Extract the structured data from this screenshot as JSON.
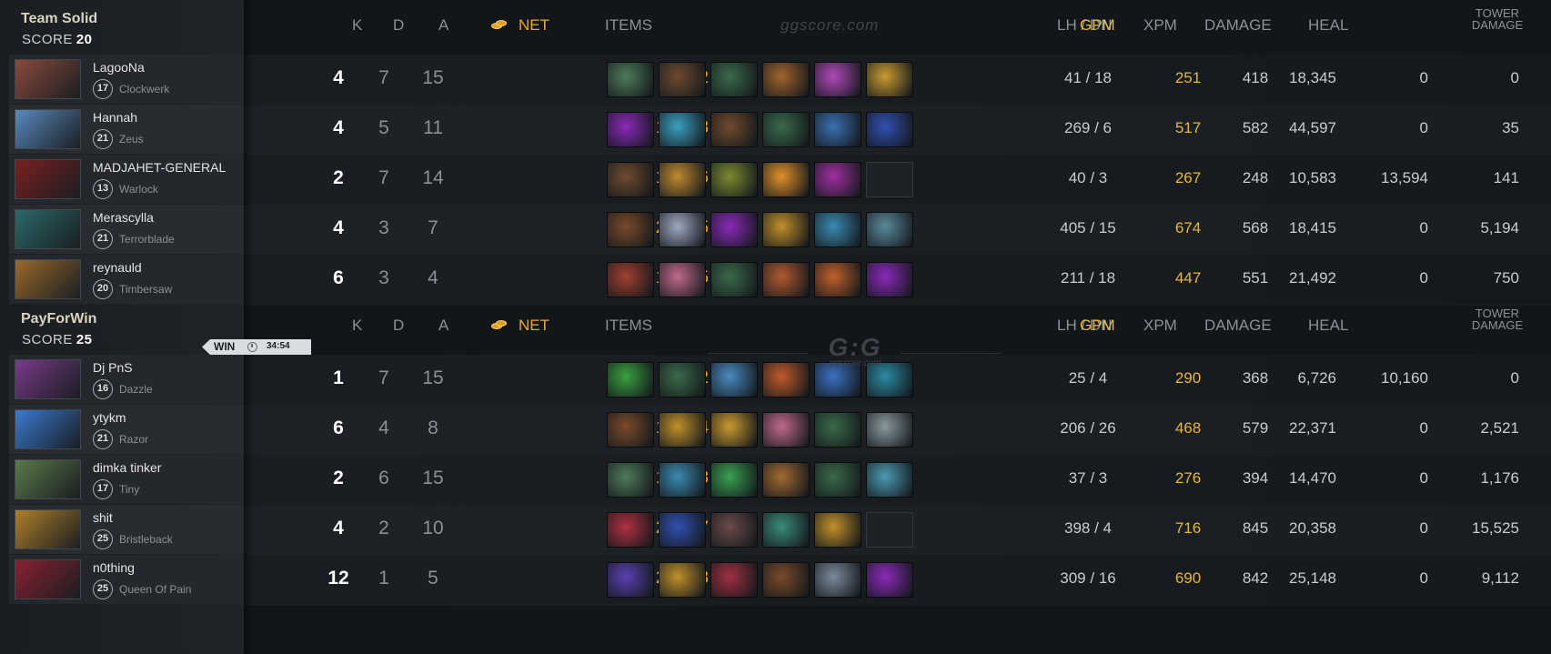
{
  "watermark_top": "ggscore.com",
  "logo": {
    "main": "G:G",
    "sub": "ggscore.com"
  },
  "columns": {
    "k": "K",
    "d": "D",
    "a": "A",
    "net": "NET",
    "items": "ITEMS",
    "lhdn": "LH  /  DN",
    "gpm": "GPM",
    "xpm": "XPM",
    "damage": "DAMAGE",
    "heal": "HEAL",
    "tower_line1": "TOWER",
    "tower_line2": "DAMAGE"
  },
  "result": {
    "label": "WIN",
    "time": "34:54",
    "clock_icon": "clock-icon"
  },
  "colors": {
    "gold": "#e8a830",
    "gpm": "#e8b830",
    "background": "#121619"
  },
  "teams": [
    {
      "name": "Team Solid",
      "score_label": "SCORE",
      "score": "20",
      "players": [
        {
          "name": "LagooNa",
          "level": "17",
          "hero": "Clockwerk",
          "k": "4",
          "d": "7",
          "a": "15",
          "net": "9,182",
          "lhdn": "41  /  18",
          "gpm": "251",
          "xpm": "418",
          "damage": "18,345",
          "heal": "0",
          "tower": "0",
          "portrait": "#8a4a3c",
          "items": [
            "#4f7a5a",
            "#6e4a2e",
            "#3a6a4a",
            "#a0642c",
            "#b04ab8",
            "#c89a30"
          ]
        },
        {
          "name": "Hannah",
          "level": "21",
          "hero": "Zeus",
          "k": "4",
          "d": "5",
          "a": "11",
          "net": "16,473",
          "lhdn": "269  /  6",
          "gpm": "517",
          "xpm": "582",
          "damage": "44,597",
          "heal": "0",
          "tower": "35",
          "portrait": "#5a8ac0",
          "items": [
            "#8a2ab8",
            "#3aa0c0",
            "#6e4a2e",
            "#3a6a4a",
            "#3a70b0",
            "#3050b0"
          ]
        },
        {
          "name": "MADJAHET-GENERAL",
          "level": "13",
          "hero": "Warlock",
          "k": "2",
          "d": "7",
          "a": "14",
          "net": "10,256",
          "lhdn": "40  /  3",
          "gpm": "267",
          "xpm": "248",
          "damage": "10,583",
          "heal": "13,594",
          "tower": "141",
          "portrait": "#7a2020",
          "items": [
            "#6e4a2e",
            "#c08a30",
            "#7a8a30",
            "#e0902a",
            "#a030a0",
            null
          ]
        },
        {
          "name": "Merascylla",
          "level": "21",
          "hero": "Terrorblade",
          "k": "4",
          "d": "3",
          "a": "7",
          "net": "23,405",
          "lhdn": "405  /  15",
          "gpm": "674",
          "xpm": "568",
          "damage": "18,415",
          "heal": "0",
          "tower": "5,194",
          "portrait": "#2a6a6a",
          "items": [
            "#7a4a2a",
            "#a0a8c0",
            "#8a2ab8",
            "#c0902a",
            "#3a8ab0",
            "#5a8a9a"
          ]
        },
        {
          "name": "reynauld",
          "level": "20",
          "hero": "Timbersaw",
          "k": "6",
          "d": "3",
          "a": "4",
          "net": "16,695",
          "lhdn": "211  /  18",
          "gpm": "447",
          "xpm": "551",
          "damage": "21,492",
          "heal": "0",
          "tower": "750",
          "portrait": "#9a6a2a",
          "items": [
            "#a04030",
            "#c06a8a",
            "#3a6a4a",
            "#b05a30",
            "#c0602a",
            "#8a2ab8"
          ]
        }
      ]
    },
    {
      "name": "PayForWin",
      "score_label": "SCORE",
      "score": "25",
      "players": [
        {
          "name": "Dj PnS",
          "level": "16",
          "hero": "Dazzle",
          "k": "1",
          "d": "7",
          "a": "15",
          "net": "9,672",
          "lhdn": "25  /  4",
          "gpm": "290",
          "xpm": "368",
          "damage": "6,726",
          "heal": "10,160",
          "tower": "0",
          "portrait": "#7a3a8a",
          "items": [
            "#3aa040",
            "#3a6a4a",
            "#4a8ac0",
            "#c05a2a",
            "#3a70c0",
            "#2a8aa0"
          ]
        },
        {
          "name": "ytykm",
          "level": "21",
          "hero": "Razor",
          "k": "6",
          "d": "4",
          "a": "8",
          "net": "16,194",
          "lhdn": "206  /  26",
          "gpm": "468",
          "xpm": "579",
          "damage": "22,371",
          "heal": "0",
          "tower": "2,521",
          "portrait": "#3a7ad0",
          "items": [
            "#7a4a2a",
            "#c0902a",
            "#c89a30",
            "#c06a8a",
            "#3a6a4a",
            "#8a9aa0"
          ]
        },
        {
          "name": "dimka tinker",
          "level": "17",
          "hero": "Tiny",
          "k": "2",
          "d": "6",
          "a": "15",
          "net": "10,153",
          "lhdn": "37  /  3",
          "gpm": "276",
          "xpm": "394",
          "damage": "14,470",
          "heal": "0",
          "tower": "1,176",
          "portrait": "#5a7a4a",
          "items": [
            "#4f7a5a",
            "#3a8ab0",
            "#3aa050",
            "#a06a30",
            "#3a6a4a",
            "#4a9ab0"
          ]
        },
        {
          "name": "shit",
          "level": "25",
          "hero": "Bristleback",
          "k": "4",
          "d": "2",
          "a": "10",
          "net": "25,887",
          "lhdn": "398  /  4",
          "gpm": "716",
          "xpm": "845",
          "damage": "20,358",
          "heal": "0",
          "tower": "15,525",
          "portrait": "#b0802a",
          "items": [
            "#b03040",
            "#3050b0",
            "#6a4a4a",
            "#3a8a7a",
            "#c0902a",
            null
          ]
        },
        {
          "name": "n0thing",
          "level": "25",
          "hero": "Queen Of Pain",
          "k": "12",
          "d": "1",
          "a": "5",
          "net": "24,413",
          "lhdn": "309  /  16",
          "gpm": "690",
          "xpm": "842",
          "damage": "25,148",
          "heal": "0",
          "tower": "9,112",
          "portrait": "#8a2030",
          "items": [
            "#5a40b0",
            "#c0902a",
            "#a03040",
            "#7a4a2a",
            "#7a8a9a",
            "#8a2ab8"
          ]
        }
      ]
    }
  ]
}
